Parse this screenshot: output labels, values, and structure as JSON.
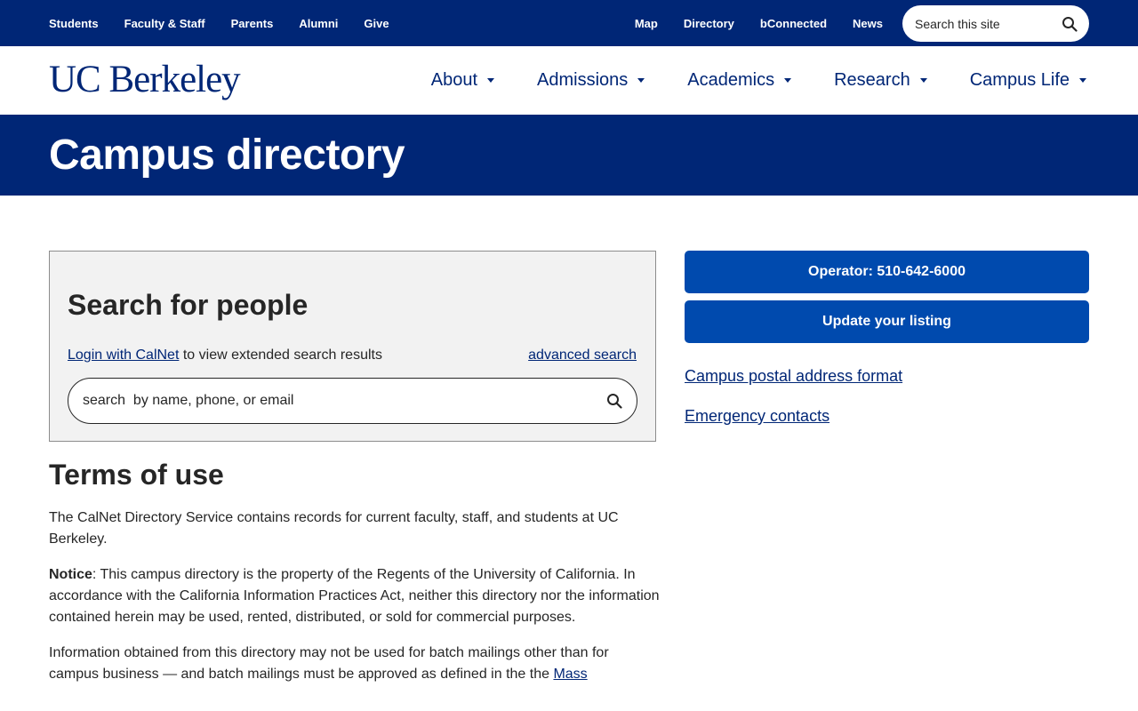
{
  "utility_nav": {
    "left": [
      "Students",
      "Faculty & Staff",
      "Parents",
      "Alumni",
      "Give"
    ],
    "right": [
      "Map",
      "Directory",
      "bConnected",
      "News"
    ],
    "search_placeholder": "Search this site"
  },
  "header": {
    "logo": "UC Berkeley",
    "nav": [
      "About",
      "Admissions",
      "Academics",
      "Research",
      "Campus Life"
    ]
  },
  "hero": {
    "title": "Campus directory"
  },
  "people_search": {
    "title": "Search for people",
    "login_link": "Login with CalNet",
    "login_suffix": " to view extended search results",
    "advanced_link": "advanced search",
    "placeholder": "search  by name, phone, or email"
  },
  "terms": {
    "title": "Terms of use",
    "p1": "The CalNet Directory Service contains records for current faculty, staff, and students at UC Berkeley.",
    "notice_label": "Notice",
    "notice_text": ": This campus directory is the property of the Regents of the University of California. In accordance with the California Information Practices Act, neither this directory nor the information contained herein may be used, rented, distributed, or sold for commercial purposes.",
    "p3": "Information obtained from this directory may not be used for batch mailings other than for campus business — and batch mailings must be approved as defined in the the ",
    "p3_link": "Mass"
  },
  "sidebar": {
    "operator_button": "Operator: 510-642-6000",
    "update_button": "Update your listing",
    "postal_link": "Campus postal address format",
    "emergency_link": "Emergency contacts"
  },
  "colors": {
    "brand_navy": "#002676",
    "button_blue": "#004aae",
    "panel_gray": "#f2f2f2"
  }
}
